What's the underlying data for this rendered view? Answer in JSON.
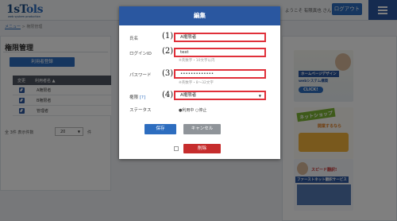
{
  "header": {
    "logo_text": "1sT",
    "logo_accent": "ols",
    "logo_sub": "web system production",
    "welcome": "ようこそ 有限真也 さん",
    "logout_label": "ログアウト"
  },
  "breadcrumb": {
    "link": "メニュー",
    "separator": " > ",
    "current": "権限管理"
  },
  "panel": {
    "title": "権限管理",
    "register_label": "利用者登録",
    "table": {
      "headers": [
        "変更",
        "利用者名 ▲"
      ],
      "rows": [
        {
          "name": "A権限者"
        },
        {
          "name": "B権限者"
        },
        {
          "name": "管理者"
        }
      ]
    },
    "pager": {
      "summary": "全 3件 表示件数",
      "page_size": "20",
      "unit": "件"
    }
  },
  "sidebar": {
    "banner1": {
      "line1": "ホームページデザイン",
      "line2": "webシステム構築",
      "line3": "CLICK!"
    },
    "banner2": {
      "line1": "ネットショップ",
      "line2": "開業するなら"
    },
    "banner3": {
      "line1": "ファーストネット翻訳サービス",
      "line2": "スピード翻訳!"
    }
  },
  "modal": {
    "title": "編集",
    "fields": {
      "name": {
        "label": "氏名",
        "value": "A権限者",
        "marker": "(1)"
      },
      "login": {
        "label": "ログインID",
        "value": "test",
        "hint": "※英数字・10文字以内",
        "marker": "(2)"
      },
      "password": {
        "label": "パスワード",
        "value": "•••••••••••••",
        "hint": "※英数字・8〜32文字",
        "marker": "(3)"
      },
      "authority": {
        "label": "権限",
        "help": "[?]",
        "value": "A権限者",
        "marker": "(4)"
      },
      "status": {
        "label": "ステータス",
        "options": [
          "●利用中",
          "○停止"
        ]
      }
    },
    "save_label": "保存",
    "cancel_label": "キャンセル",
    "delete_label": "削除"
  },
  "colors": {
    "primary": "#2a57a0",
    "button": "#2d6dbf",
    "highlight": "#e0303a",
    "delete": "#c62d2d"
  }
}
